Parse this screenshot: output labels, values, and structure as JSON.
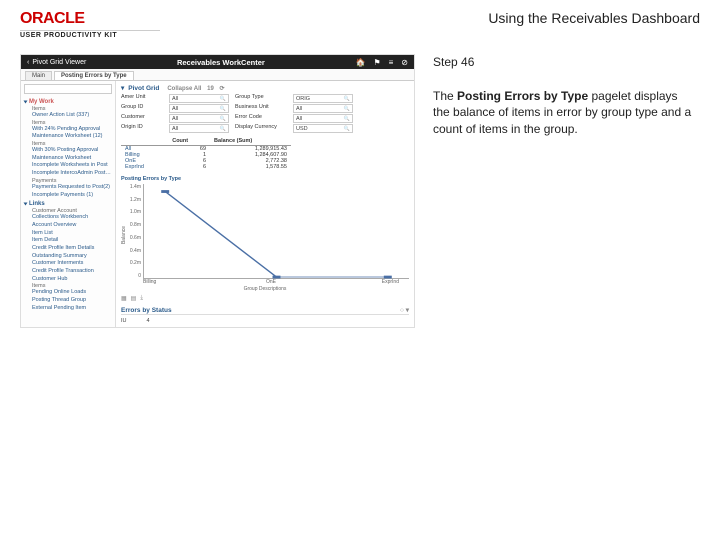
{
  "header": {
    "brand": "ORACLE",
    "sub": "USER PRODUCTIVITY KIT",
    "doc_title": "Using the Receivables Dashboard"
  },
  "instructions": {
    "step": "Step 46",
    "desc_pre": "The ",
    "desc_bold": "Posting Errors by Type",
    "desc_post": " pagelet displays the balance of items in error by group type and a count of items in the group."
  },
  "screenshot": {
    "topbar": {
      "back": "Pivot Grid Viewer",
      "title": "Receivables WorkCenter",
      "icons": [
        "🏠",
        "⚑",
        "≡",
        "⊘"
      ]
    },
    "tabs": [
      "Main",
      "Posting Errors by Type"
    ],
    "sidebar": {
      "search_placeholder": "",
      "my_work": "My Work",
      "sections": [
        {
          "title": "Items",
          "items": [
            "Owner Action List (337)"
          ]
        },
        {
          "title": "Items",
          "items": [
            "With 24% Pending Approval",
            "Maintenance Worksheet (12)"
          ]
        },
        {
          "title": "Items",
          "items": [
            "With 30% Posting Approval",
            "Maintenance Worksheet",
            "Incomplete Worksheets in Post",
            "Incomplete IntercoAdmin Post (1)"
          ]
        },
        {
          "title": "Payments",
          "items": [
            "Payments Requested to Post(2)",
            "Incomplete Payments (1)"
          ]
        },
        {
          "title": "Links",
          "collapsed": false,
          "items": []
        },
        {
          "title": "Customer Account",
          "items": [
            "Collections Workbench",
            "Account Overview",
            "Item List",
            "Item Detail",
            "Credit Profile Item Details",
            "Outstanding Summary",
            "Customer Interments",
            "Credit Profile Transaction",
            "Customer Hub"
          ]
        },
        {
          "title": "Items",
          "items": [
            "Pending Online Loads",
            "Posting Thread Group",
            "External Pending Item"
          ]
        }
      ]
    },
    "panel": {
      "title": "Pivot Grid",
      "controls": {
        "collapse": "Collapse All",
        "count": "19",
        "refresh": "⟳"
      },
      "filters": [
        {
          "label": "Amer Unit",
          "value": "All"
        },
        {
          "label": "Group Type",
          "value": "ORIG"
        },
        {
          "label": "Group ID",
          "value": "All"
        },
        {
          "label": "Business Unit",
          "value": "All"
        },
        {
          "label": "Customer",
          "value": "All"
        },
        {
          "label": "Error Code",
          "value": "All"
        },
        {
          "label": "Origin ID",
          "value": "All"
        },
        {
          "label": "Display Currency",
          "value": "USD"
        }
      ],
      "table": {
        "headers": [
          "",
          "Count",
          "Balance (Sum)"
        ],
        "rows": [
          [
            "All",
            "69",
            "1,289,915.43"
          ],
          [
            "Billing",
            "1",
            "1,284,607.90"
          ],
          [
            "OnE",
            "6",
            "2,772.38"
          ],
          [
            "ExprInd",
            "6",
            "1,578.55"
          ]
        ]
      },
      "section2": {
        "title": "Errors by Status",
        "rows": [
          [
            "IU",
            "4"
          ]
        ]
      }
    }
  },
  "chart_data": {
    "type": "line",
    "title": "Posting Errors by Type",
    "xlabel": "Group Descriptions",
    "ylabel": "Balance",
    "ylim": [
      0,
      1400000
    ],
    "yticks": [
      "1.4m",
      "1.2m",
      "1.0m",
      "0.8m",
      "0.6m",
      "0.4m",
      "0.2m",
      "0"
    ],
    "categories": [
      "Billing",
      "OnE",
      "ExprInd"
    ],
    "values": [
      1284607.9,
      2772.38,
      1578.55
    ]
  }
}
